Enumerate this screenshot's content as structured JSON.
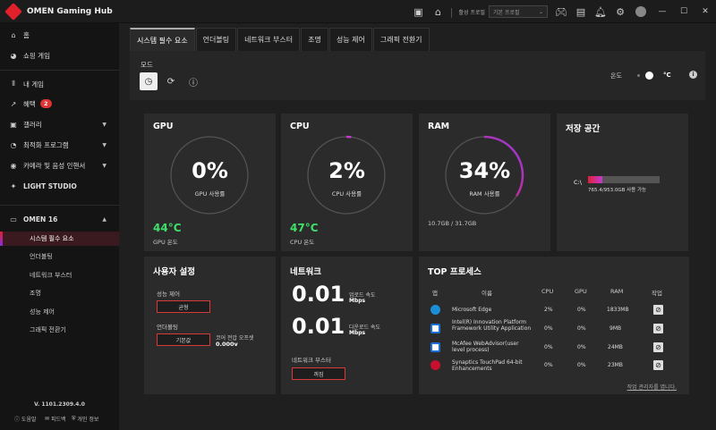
{
  "app": {
    "title": "OMEN Gaming Hub"
  },
  "titlebar": {
    "profile_label": "활성 프로필",
    "profile_value": "기본 프로필"
  },
  "sidebar": {
    "home": "홈",
    "shop": "쇼핑 게임",
    "library": "내 게임",
    "rewards": "혜택",
    "rewards_badge": "2",
    "gallery": "갤러리",
    "optimizer": "최적화 프로그램",
    "camera": "카메라 및 음성 인핸서",
    "light": "LIGHT STUDIO",
    "device": "OMEN 16",
    "sub": [
      "시스템 필수 요소",
      "언더볼팅",
      "네트워크 부스터",
      "조명",
      "성능 제어",
      "그래픽 전환기"
    ],
    "version": "V. 1101.2309.4.0",
    "footer": [
      "도움말",
      "피드백",
      "개인 정보"
    ]
  },
  "tabs": [
    "시스템 필수 요소",
    "언더볼팅",
    "네트워크 부스터",
    "조명",
    "성능 제어",
    "그래픽 전환기"
  ],
  "mode": {
    "label": "모드",
    "temp_label": "온도",
    "unit": "°C"
  },
  "gpu": {
    "title": "GPU",
    "value": "0%",
    "sub": "GPU 사용률",
    "percent": 0,
    "temp": "44°C",
    "temp_label": "GPU 온도"
  },
  "cpu": {
    "title": "CPU",
    "value": "2%",
    "sub": "CPU 사용률",
    "percent": 2,
    "temp": "47°C",
    "temp_label": "CPU 온도"
  },
  "ram": {
    "title": "RAM",
    "value": "34%",
    "sub": "RAM 사용률",
    "percent": 34,
    "usage": "10.7GB / 31.7GB"
  },
  "storage": {
    "title": "저장 공간",
    "drive": "C:\\",
    "fill_percent": 20,
    "free": "765.4/953.0GB 사용 가능"
  },
  "user_settings": {
    "title": "사용자 설정",
    "perf_label": "성능 제어",
    "perf_value": "균형",
    "uv_label": "언더볼팅",
    "uv_value": "기본값",
    "core_label": "코어 전압 오프셋",
    "core_value": "0.000v"
  },
  "network": {
    "title": "네트워크",
    "up_value": "0.01",
    "up_label": "업로드 속도",
    "up_unit": "Mbps",
    "down_value": "0.01",
    "down_label": "다운로드 속도",
    "down_unit": "Mbps",
    "booster_label": "네트워크 부스터",
    "booster_value": "꺼짐"
  },
  "top_processes": {
    "title": "TOP 프로세스",
    "headers": [
      "앱",
      "이름",
      "CPU",
      "GPU",
      "RAM",
      "작업"
    ],
    "rows": [
      {
        "name": "Microsoft Edge",
        "cpu": "2%",
        "gpu": "0%",
        "ram": "1833MB",
        "icon_color": "#1a8fd8"
      },
      {
        "name": "Intel(R) Innovation Platform Framework Utility Application",
        "cpu": "0%",
        "gpu": "0%",
        "ram": "9MB",
        "icon_color": "#ffffff"
      },
      {
        "name": "McAfee WebAdvisor(user level process)",
        "cpu": "0%",
        "gpu": "0%",
        "ram": "24MB",
        "icon_color": "#ffffff"
      },
      {
        "name": "Synaptics TouchPad 64-bit Enhancements",
        "cpu": "0%",
        "gpu": "0%",
        "ram": "23MB",
        "icon_color": "#c8102e"
      }
    ],
    "link": "작업 관리자를 엽니다."
  }
}
